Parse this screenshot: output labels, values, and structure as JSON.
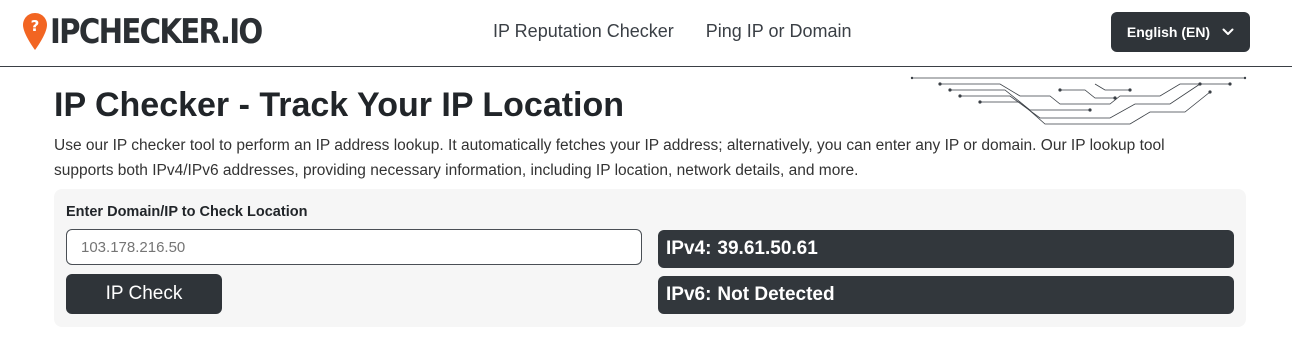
{
  "header": {
    "logo_text": "IPCHECKER.IO",
    "nav": [
      {
        "label": "IP Reputation Checker"
      },
      {
        "label": "Ping IP or Domain"
      }
    ],
    "language_button": "English (EN)"
  },
  "main": {
    "title": "IP Checker - Track Your IP Location",
    "description": "Use our IP checker tool to perform an IP address lookup. It automatically fetches your IP address; alternatively, you can enter any IP or domain. Our IP lookup tool supports both IPv4/IPv6 addresses, providing necessary information, including IP location, network details, and more.",
    "form": {
      "label": "Enter Domain/IP to Check Location",
      "input_placeholder": "103.178.216.50",
      "button_label": "IP Check"
    },
    "results": {
      "ipv4_label": "IPv4:",
      "ipv4_value": "39.61.50.61",
      "ipv6_label": "IPv6:",
      "ipv6_value": "Not Detected"
    }
  },
  "colors": {
    "brand_orange": "#f26522",
    "dark": "#2f3439"
  },
  "icons": {
    "logo": "location-pin-icon",
    "language_dropdown": "chevron-down-icon"
  }
}
